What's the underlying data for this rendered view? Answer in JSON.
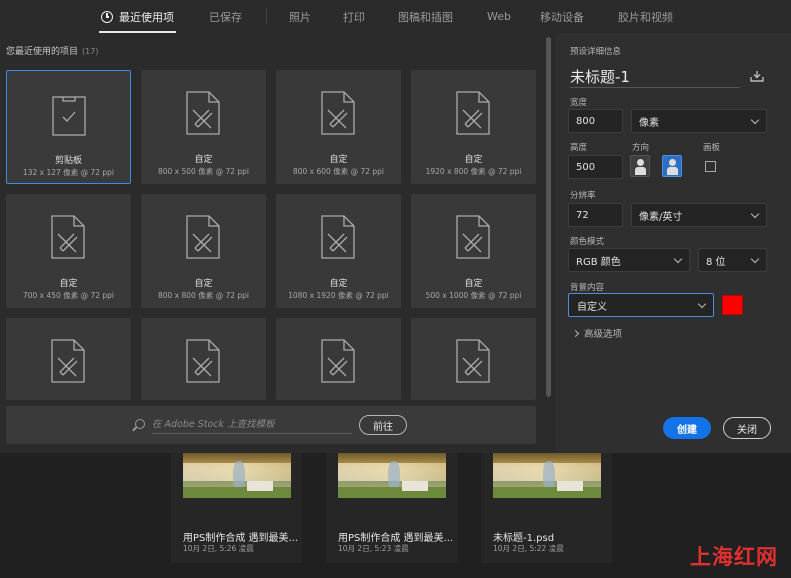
{
  "tabs": [
    {
      "label": "最近使用项",
      "active": true
    },
    {
      "label": "已保存"
    },
    {
      "label": "照片"
    },
    {
      "label": "打印"
    },
    {
      "label": "图稿和插图"
    },
    {
      "label": "Web"
    },
    {
      "label": "移动设备"
    },
    {
      "label": "胶片和视频"
    }
  ],
  "recent": {
    "title": "您最近使用的项目",
    "count": "(17)",
    "items": [
      {
        "name": "剪贴板",
        "size": "132 x 127 像素 @ 72 ppi",
        "icon": "clipboard-check-icon",
        "selected": true
      },
      {
        "name": "自定",
        "size": "800 x 500 像素 @ 72 ppi",
        "icon": "document-pencil-icon"
      },
      {
        "name": "自定",
        "size": "800 x 600 像素 @ 72 ppi",
        "icon": "document-pencil-icon"
      },
      {
        "name": "自定",
        "size": "1920 x 800 像素 @ 72 ppi",
        "icon": "document-pencil-icon"
      },
      {
        "name": "自定",
        "size": "700 x 450 像素 @ 72 ppi",
        "icon": "document-pencil-icon"
      },
      {
        "name": "自定",
        "size": "800 x 800 像素 @ 72 ppi",
        "icon": "document-pencil-icon"
      },
      {
        "name": "自定",
        "size": "1080 x 1920 像素 @ 72 ppi",
        "icon": "document-pencil-icon"
      },
      {
        "name": "自定",
        "size": "500 x 1000 像素 @ 72 ppi",
        "icon": "document-pencil-icon"
      }
    ]
  },
  "search": {
    "placeholder": "在 Adobe Stock 上查找模板",
    "button": "前往"
  },
  "details": {
    "header": "预设详细信息",
    "doc_title": "未标题-1",
    "width_label": "宽度",
    "width_value": "800",
    "width_unit": "像素",
    "height_label": "高度",
    "height_value": "500",
    "orientation_label": "方向",
    "artboard_label": "画板",
    "resolution_label": "分辨率",
    "resolution_value": "72",
    "resolution_unit": "像素/英寸",
    "color_mode_label": "颜色模式",
    "color_mode": "RGB 颜色",
    "bit_depth": "8 位",
    "bg_label": "背景内容",
    "bg_value": "自定义",
    "bg_color": "#ff0000",
    "advanced": "高级选项",
    "create": "创建",
    "close": "关闭"
  },
  "files": [
    {
      "name": "用PS制作合成 遇到最美...",
      "date": "10月 2日, 5:26 凌晨"
    },
    {
      "name": "用PS制作合成 遇到最美...",
      "date": "10月 2日, 5:23 凌晨"
    },
    {
      "name": "未标题-1.psd",
      "date": "10月 2日, 5:22 凌晨"
    }
  ],
  "watermark": "上海红网"
}
